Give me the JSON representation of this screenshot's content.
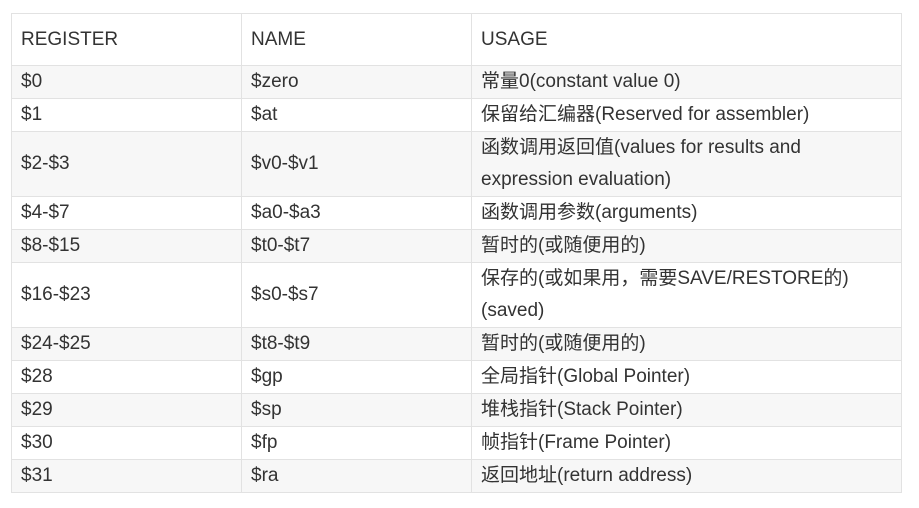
{
  "table": {
    "headers": [
      "REGISTER",
      "NAME",
      "USAGE"
    ],
    "rows": [
      [
        "$0",
        "$zero",
        "常量0(constant value 0)"
      ],
      [
        "$1",
        "$at",
        "保留给汇编器(Reserved for assembler)"
      ],
      [
        "$2-$3",
        "$v0-$v1",
        "函数调用返回值(values for results and expression evaluation)"
      ],
      [
        "$4-$7",
        "$a0-$a3",
        "函数调用参数(arguments)"
      ],
      [
        "$8-$15",
        "$t0-$t7",
        "暂时的(或随便用的)"
      ],
      [
        "$16-$23",
        "$s0-$s7",
        "保存的(或如果用，需要SAVE/RESTORE的)(saved)"
      ],
      [
        "$24-$25",
        "$t8-$t9",
        "暂时的(或随便用的)"
      ],
      [
        "$28",
        "$gp",
        "全局指针(Global Pointer)"
      ],
      [
        "$29",
        "$sp",
        "堆栈指针(Stack Pointer)"
      ],
      [
        "$30",
        "$fp",
        "帧指针(Frame Pointer)"
      ],
      [
        "$31",
        "$ra",
        "返回地址(return address)"
      ]
    ]
  }
}
